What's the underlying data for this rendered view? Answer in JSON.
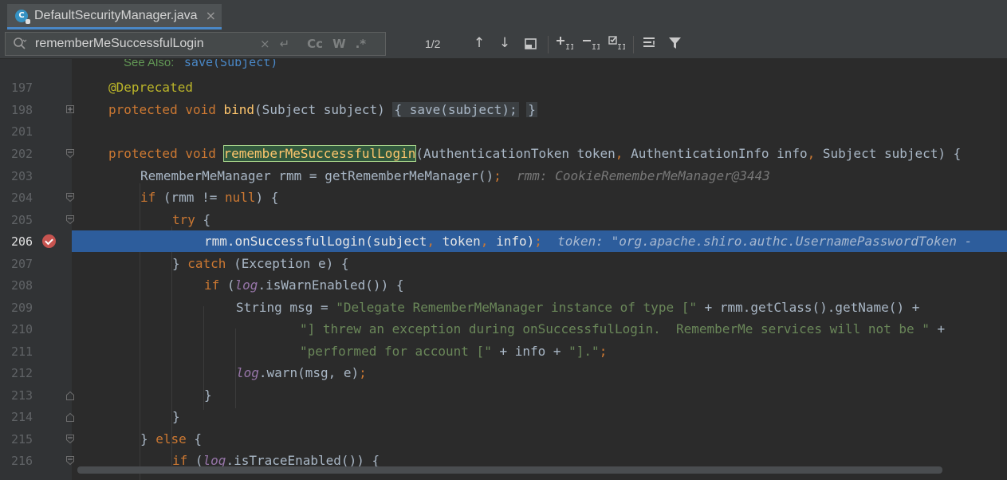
{
  "tab": {
    "title": "DefaultSecurityManager.java",
    "icon_letter": "C",
    "close": "×"
  },
  "search": {
    "query": "rememberMeSuccessfulLogin",
    "match_count": "1/2",
    "clear": "×",
    "newline": "↵",
    "case": "Cc",
    "words": "W",
    "regex": ".*"
  },
  "toolbar": {
    "prev": "↑",
    "next": "↓",
    "select_all": "⊡",
    "add_selection": "+ɪ",
    "remove_selection": "−ɪ",
    "select_all_occ": "☑",
    "multiline": "≡",
    "filter": "▼"
  },
  "editor": {
    "doc_line": {
      "label": "See Also:",
      "link": "save(Subject)"
    },
    "lines": [
      {
        "num": "197"
      },
      {
        "num": "198"
      },
      {
        "num": "201"
      },
      {
        "num": "202"
      },
      {
        "num": "203"
      },
      {
        "num": "204"
      },
      {
        "num": "205"
      },
      {
        "num": "206"
      },
      {
        "num": "207"
      },
      {
        "num": "208"
      },
      {
        "num": "209"
      },
      {
        "num": "210"
      },
      {
        "num": "211"
      },
      {
        "num": "212"
      },
      {
        "num": "213"
      },
      {
        "num": "214"
      },
      {
        "num": "215"
      },
      {
        "num": "216"
      }
    ],
    "t": {
      "l197": "@Deprecated",
      "kw_protected": "protected",
      "kw_void": "void",
      "bind": "bind",
      "l198_params": "(Subject subject)",
      "l198_body": "{ save(subject);",
      "l198_close": "}",
      "method_name": "rememberMeSuccessfulLogin",
      "l202_params_a": "(AuthenticationToken token",
      "l202_params_b": " AuthenticationInfo info",
      "l202_params_c": " Subject subject) {",
      "l203_code": "RememberMeManager rmm = getRememberMeManager()",
      "l203_hint": "rmm: CookieRememberMeManager@3443",
      "kw_if": "if",
      "kw_null": "null",
      "l204_a": " (rmm != ",
      "l204_b": ") {",
      "kw_try": "try",
      "brace_open": " {",
      "l206_a": "rmm.onSuccessfulLogin(subject",
      "l206_b": " token",
      "l206_c": " info)",
      "l206_hint": "token: \"org.apache.shiro.authc.UsernamePasswordToken - ",
      "l207_a": "} ",
      "kw_catch": "catch",
      "l207_b": " (Exception e) {",
      "kw_log": "log",
      "l208_b": ".isWarnEnabled()) {",
      "l209_a": "String msg = ",
      "l209_str": "\"Delegate RememberMeManager instance of type [\"",
      "l209_b": " + rmm.getClass().getName() +",
      "l210_str": "\"] threw an exception during onSuccessfulLogin.  RememberMe services will not be \"",
      "l210_b": " +",
      "l211_str1": "\"performed for account [\"",
      "l211_b": " + info + ",
      "l211_str2": "\"].\"",
      "l212_b": ".warn(msg, e)",
      "close_brace": "}",
      "l215_a": "} ",
      "kw_else": "else",
      "l216_b": ".isTraceEnabled()) {",
      "comma": ",",
      "semicolon": ";",
      "paren_open": " ("
    }
  },
  "colors": {
    "keyword": "#cc7832",
    "annotation": "#bbb529",
    "method": "#ffc66d",
    "string": "#6a8759",
    "field": "#9876aa",
    "execution_line": "#2d5d9c",
    "breakpoint": "#c75450"
  }
}
